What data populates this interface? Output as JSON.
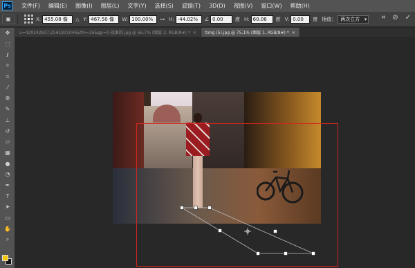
{
  "app": {
    "logo": "Ps"
  },
  "menu": [
    "文件(F)",
    "编辑(E)",
    "图像(I)",
    "图层(L)",
    "文字(Y)",
    "选择(S)",
    "滤镜(T)",
    "3D(D)",
    "视图(V)",
    "窗口(W)",
    "帮助(H)"
  ],
  "options": {
    "x_label": "X:",
    "x_value": "455.08 像",
    "y_label": "Y:",
    "y_value": "467.50 像",
    "w_label": "W:",
    "w_value": "100.00%",
    "h_label": "H:",
    "h_value": "-44.02%",
    "angle_value": "0.00",
    "angle_unit": "度",
    "hskew_label": "H:",
    "hskew_value": "60.06",
    "hskew_unit": "度",
    "vskew_label": "V:",
    "vskew_value": "0.00",
    "vskew_unit": "度",
    "interp_label": "插值：",
    "interp_value": "两次立方"
  },
  "tabs": [
    {
      "label": "u=420242837,2561831046&fm=26&gp=0-效果的.jpg @ 66.7% (图层 2, RGB/8#) *",
      "close": "×",
      "active": false
    },
    {
      "label": "timg (5).jpg @ 75.1% (图层 1, RGB/8#) *",
      "close": "×",
      "active": true
    }
  ],
  "tools": [
    "move-icon",
    "marquee-icon",
    "lasso-icon",
    "magic-wand-icon",
    "crop-icon",
    "eyedropper-icon",
    "healing-icon",
    "brush-icon",
    "stamp-icon",
    "history-brush-icon",
    "eraser-icon",
    "gradient-icon",
    "blur-icon",
    "dodge-icon",
    "pen-icon",
    "type-icon",
    "path-select-icon",
    "shape-icon",
    "hand-icon",
    "zoom-icon"
  ],
  "colors": {
    "foreground": "#f5c400",
    "background": "#111111",
    "selection": "#d4261d"
  }
}
